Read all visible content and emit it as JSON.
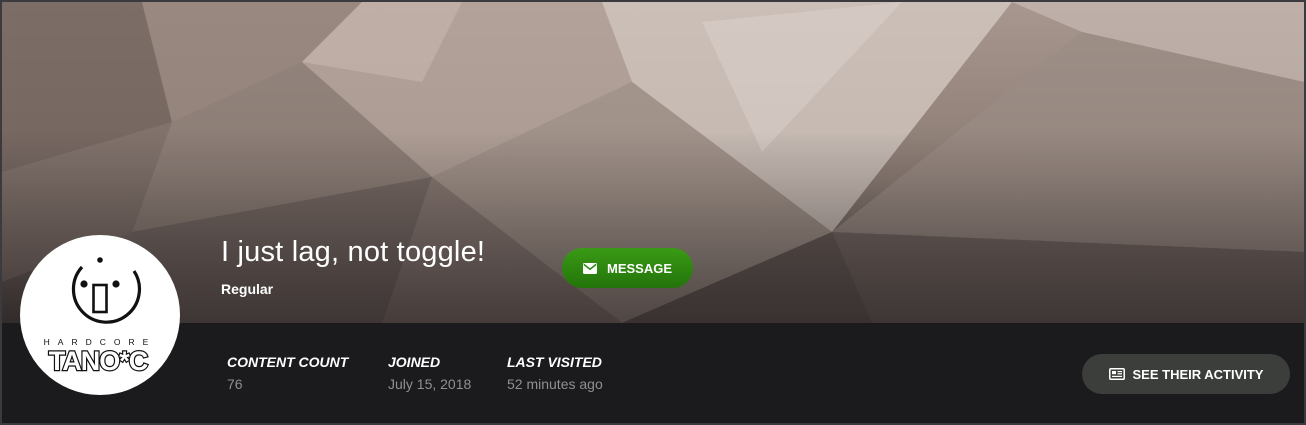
{
  "profile": {
    "username": "I just lag, not toggle!",
    "group": "Regular",
    "avatar_text_top": "HARDCORE",
    "avatar_text_main": "TANO*C"
  },
  "actions": {
    "message_label": "MESSAGE",
    "message_icon": "envelope-icon",
    "activity_label": "SEE THEIR ACTIVITY",
    "activity_icon": "newspaper-icon"
  },
  "stats": [
    {
      "label": "CONTENT COUNT",
      "value": "76"
    },
    {
      "label": "JOINED",
      "value": "July 15, 2018"
    },
    {
      "label": "LAST VISITED",
      "value": "52 minutes ago"
    }
  ],
  "colors": {
    "message_button": "#2e8a10",
    "activity_button": "#3b3e3a",
    "stats_background": "#1b1b1e"
  }
}
